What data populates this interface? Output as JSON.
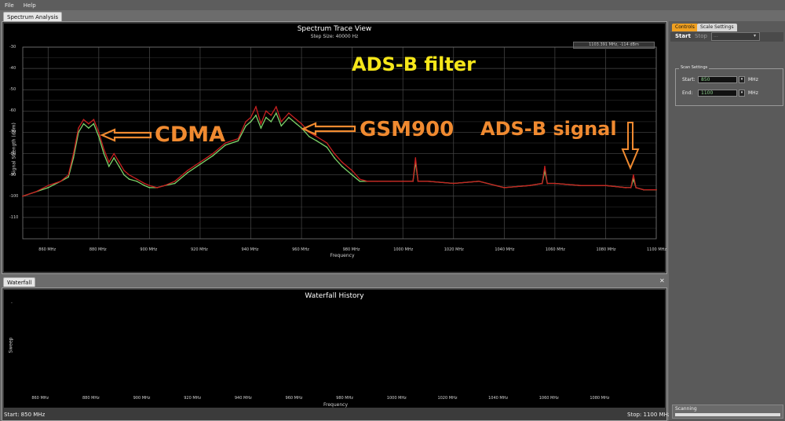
{
  "menu": {
    "file": "File",
    "help": "Help"
  },
  "tabs": {
    "spectrum_analysis": "Spectrum Analysis",
    "waterfall": "Waterfall",
    "close_glyph": "✕"
  },
  "spectrum": {
    "title": "Spectrum Trace View",
    "subtitle": "Step Size: 40000 Hz",
    "marker_readout": "1103.391 MHz, -114 dBm",
    "ylabel": "Signal Strength (dBm)",
    "xlabel": "Frequency",
    "y_ticks": [
      "-30",
      "-40",
      "-50",
      "-60",
      "-70",
      "-80",
      "-90",
      "-100",
      "-110"
    ],
    "x_ticks": [
      "860 MHz",
      "880 MHz",
      "900 MHz",
      "920 MHz",
      "940 MHz",
      "960 MHz",
      "980 MHz",
      "1000 MHz",
      "1020 MHz",
      "1040 MHz",
      "1060 MHz",
      "1080 MHz",
      "1100 MHz"
    ]
  },
  "annotations": {
    "adsb_filter": "ADS-B filter",
    "cdma": "CDMA",
    "gsm900": "GSM900",
    "adsb_signal": "ADS-B signal",
    "colors": {
      "yellow": "#f5e61a",
      "orange": "#f08a30"
    }
  },
  "waterfall": {
    "title": "Waterfall History",
    "ylabel": "Sweep",
    "xlabel": "Frequency",
    "y_tick": "-",
    "x_ticks": [
      "860 MHz",
      "880 MHz",
      "900 MHz",
      "920 MHz",
      "940 MHz",
      "960 MHz",
      "980 MHz",
      "1000 MHz",
      "1020 MHz",
      "1040 MHz",
      "1060 MHz",
      "1080 MHz"
    ],
    "start_label": "Start: 850 MHz",
    "stop_label": "Stop: 1100 MHz"
  },
  "controls": {
    "tab_controls": "Controls",
    "tab_scale": "Scale Settings",
    "start_button": "Start",
    "stop_button": "Stop",
    "device_select": "...",
    "scan_settings_legend": "Scan Settings",
    "start_label": "Start:",
    "start_value": "850",
    "end_label": "End:",
    "end_value": "1100",
    "unit": "MHz",
    "status": "Scanning"
  },
  "chart_data": {
    "type": "line",
    "title": "Spectrum Trace View",
    "xlabel": "Frequency",
    "ylabel": "Signal Strength (dBm)",
    "xlim": [
      850,
      1100
    ],
    "ylim": [
      -120,
      -30
    ],
    "grid": true,
    "series": [
      {
        "color": "#c82020",
        "x": [
          850,
          855,
          860,
          865,
          868,
          870,
          872,
          874,
          876,
          878,
          880,
          882,
          884,
          886,
          888,
          890,
          892,
          895,
          898,
          900,
          903,
          906,
          910,
          915,
          920,
          925,
          930,
          935,
          938,
          940,
          942,
          944,
          946,
          948,
          950,
          952,
          955,
          958,
          960,
          963,
          966,
          970,
          973,
          976,
          980,
          983,
          986,
          990,
          995,
          1000,
          1004,
          1005,
          1006,
          1010,
          1020,
          1030,
          1040,
          1050,
          1055,
          1056,
          1057,
          1060,
          1070,
          1080,
          1088,
          1090,
          1091,
          1092,
          1095,
          1100
        ],
        "y": [
          -100,
          -98,
          -95,
          -93,
          -90,
          -80,
          -68,
          -64,
          -66,
          -64,
          -70,
          -78,
          -84,
          -80,
          -84,
          -88,
          -90,
          -92,
          -94,
          -95,
          -96,
          -95,
          -93,
          -88,
          -84,
          -80,
          -75,
          -73,
          -65,
          -63,
          -58,
          -66,
          -60,
          -62,
          -58,
          -65,
          -61,
          -64,
          -66,
          -70,
          -72,
          -75,
          -80,
          -84,
          -88,
          -92,
          -93,
          -93,
          -93,
          -93,
          -93,
          -82,
          -93,
          -93,
          -94,
          -93,
          -96,
          -95,
          -94,
          -86,
          -94,
          -94,
          -95,
          -95,
          -96,
          -96,
          -90,
          -96,
          -97,
          -97
        ]
      },
      {
        "color": "#7cd36a",
        "x": [
          850,
          855,
          860,
          865,
          868,
          870,
          872,
          874,
          876,
          878,
          880,
          882,
          884,
          886,
          888,
          890,
          892,
          895,
          898,
          900,
          903,
          906,
          910,
          915,
          920,
          925,
          930,
          935,
          938,
          940,
          942,
          944,
          946,
          948,
          950,
          952,
          955,
          958,
          960,
          963,
          966,
          970,
          973,
          976,
          980,
          983,
          986,
          990,
          995,
          1000,
          1004,
          1005,
          1006,
          1010,
          1020,
          1030,
          1040,
          1050,
          1055,
          1056,
          1057,
          1060,
          1070,
          1080,
          1088,
          1090,
          1091,
          1092,
          1095,
          1100
        ],
        "y": [
          -100,
          -98,
          -96,
          -93,
          -91,
          -82,
          -70,
          -66,
          -68,
          -66,
          -72,
          -80,
          -86,
          -82,
          -86,
          -90,
          -92,
          -93,
          -95,
          -96,
          -96,
          -95,
          -94,
          -89,
          -85,
          -81,
          -76,
          -74,
          -67,
          -65,
          -62,
          -68,
          -63,
          -65,
          -61,
          -67,
          -63,
          -66,
          -68,
          -72,
          -74,
          -77,
          -82,
          -86,
          -90,
          -93,
          -93,
          -93,
          -93,
          -93,
          -93,
          -84,
          -93,
          -93,
          -94,
          -93,
          -96,
          -95,
          -94,
          -88,
          -94,
          -94,
          -95,
          -95,
          -96,
          -96,
          -92,
          -96,
          -97,
          -97
        ]
      }
    ]
  }
}
